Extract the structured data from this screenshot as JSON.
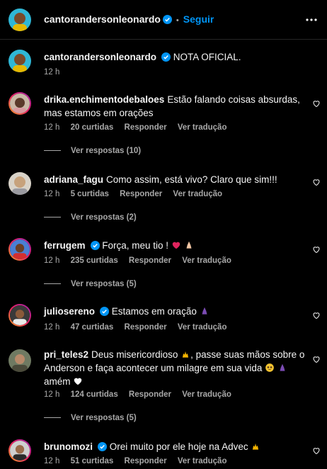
{
  "header": {
    "username": "cantorandersonleonardo",
    "separator": "•",
    "follow_label": "Seguir"
  },
  "caption": {
    "username": "cantorandersonleonardo",
    "text": "NOTA OFICIAL.",
    "time": "12 h"
  },
  "comments": [
    {
      "username": "drika.enchimentodebaloes",
      "verified": false,
      "text": "Estão falando coisas absurdas, mas estamos em orações",
      "time": "12 h",
      "likes": "20 curtidas",
      "reply_label": "Responder",
      "translate_label": "Ver tradução",
      "view_replies": "Ver respostas (10)"
    },
    {
      "username": "adriana_fagu",
      "verified": false,
      "text": "Como assim, está vivo? Claro que sim!!!",
      "time": "12 h",
      "likes": "5 curtidas",
      "reply_label": "Responder",
      "translate_label": "Ver tradução",
      "view_replies": "Ver respostas (2)"
    },
    {
      "username": "ferrugem",
      "verified": true,
      "text": "Força, meu tio !",
      "time": "12 h",
      "likes": "235 curtidas",
      "reply_label": "Responder",
      "translate_label": "Ver tradução",
      "view_replies": "Ver respostas (5)",
      "emojis": [
        "red-heart-emoji",
        "praying-hands-emoji"
      ]
    },
    {
      "username": "juliosereno",
      "verified": true,
      "text": "Estamos em oração",
      "time": "12 h",
      "likes": "47 curtidas",
      "reply_label": "Responder",
      "translate_label": "Ver tradução",
      "emojis": [
        "praying-hands-emoji"
      ]
    },
    {
      "username": "pri_teles2",
      "verified": false,
      "text_1": "Deus misericordioso",
      "text_2": ", passe suas mãos sobre o Anderson e faça acontecer um milagre em sua vida",
      "text_3": "amém",
      "time": "12 h",
      "likes": "124 curtidas",
      "reply_label": "Responder",
      "translate_label": "Ver tradução",
      "view_replies": "Ver respostas (5)",
      "emojis": [
        "raised-hands-emoji",
        "pleading-face-emoji",
        "praying-hands-emoji",
        "white-heart-emoji"
      ]
    },
    {
      "username": "brunomozi",
      "verified": true,
      "text": "Orei muito por ele hoje na Advec",
      "time": "12 h",
      "likes": "51 curtidas",
      "reply_label": "Responder",
      "translate_label": "Ver tradução",
      "emojis": [
        "raised-hands-emoji"
      ]
    }
  ],
  "colors": {
    "background": "#000000",
    "text": "#f5f5f5",
    "muted": "#a8a8a8",
    "link": "#0095f6",
    "verified": "#0095f6"
  }
}
